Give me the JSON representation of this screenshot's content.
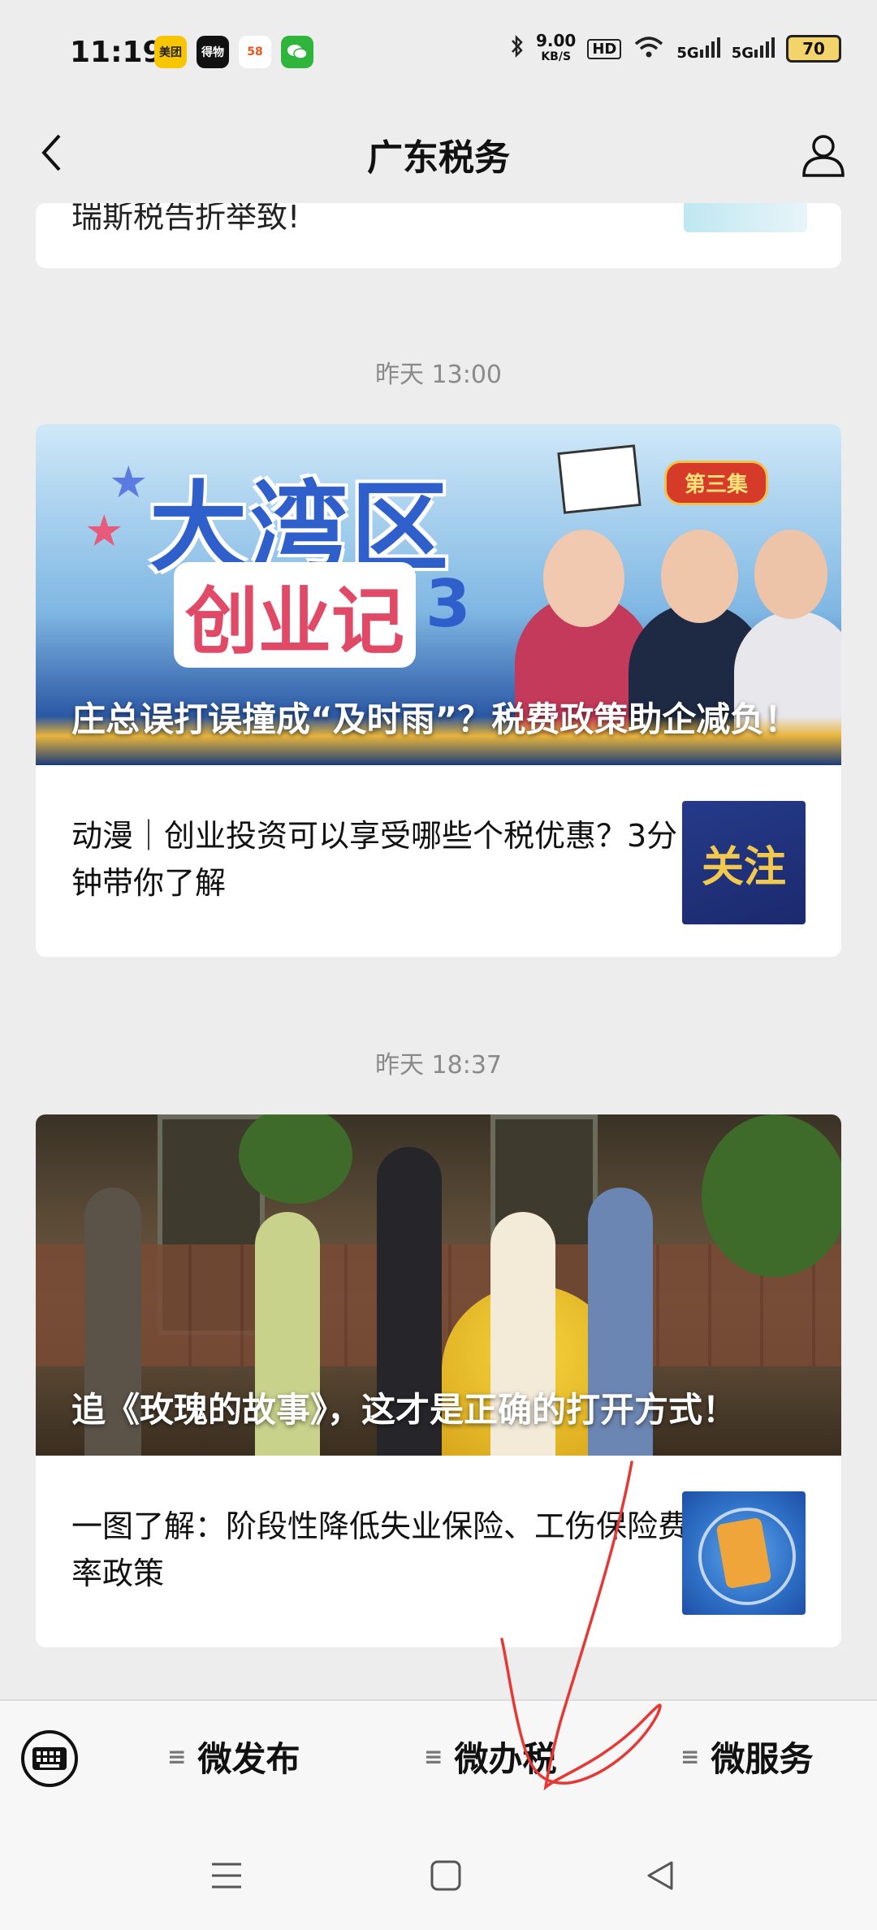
{
  "status_bar": {
    "time": "11:19",
    "app_icons": [
      {
        "label": "美团",
        "color": "#f7c600",
        "text_color": "#222"
      },
      {
        "label": "得物",
        "color": "#111111",
        "text_color": "#ffffff"
      },
      {
        "label": "58",
        "color": "#ffffff",
        "text_color": "#e8541e"
      },
      {
        "label": "微信",
        "color": "#2fb53c",
        "text_color": "#ffffff"
      }
    ],
    "net_speed_value": "9.00",
    "net_speed_unit": "KB/S",
    "hd_label": "HD",
    "signal_1": "5G",
    "signal_2": "5G",
    "battery": "70"
  },
  "nav": {
    "title": "广东税务"
  },
  "feed": {
    "partial_text": "瑞斯税告折举致!",
    "group1": {
      "timestamp": "昨天 13:00",
      "hero_overlay": {
        "title_big": "大湾区",
        "subtitle": "创业记",
        "num": "3",
        "badge": "第三集"
      },
      "hero_caption": "庄总误打误撞成“及时雨”？税费政策助企减负！",
      "article_text": "动漫｜创业投资可以享受哪些个税优惠？3分钟带你了解",
      "thumb_text": "关注"
    },
    "group2": {
      "timestamp": "昨天 18:37",
      "hero_caption": "追《玫瑰的故事》，这才是正确的打开方式！",
      "article_text": "一图了解：阶段性降低失业保险、工伤保险费率政策"
    }
  },
  "bottom_menu": {
    "items": [
      "微发布",
      "微办税",
      "微服务"
    ]
  },
  "colors": {
    "background": "#ededed",
    "card": "#ffffff",
    "annotation_red": "#e53935"
  }
}
